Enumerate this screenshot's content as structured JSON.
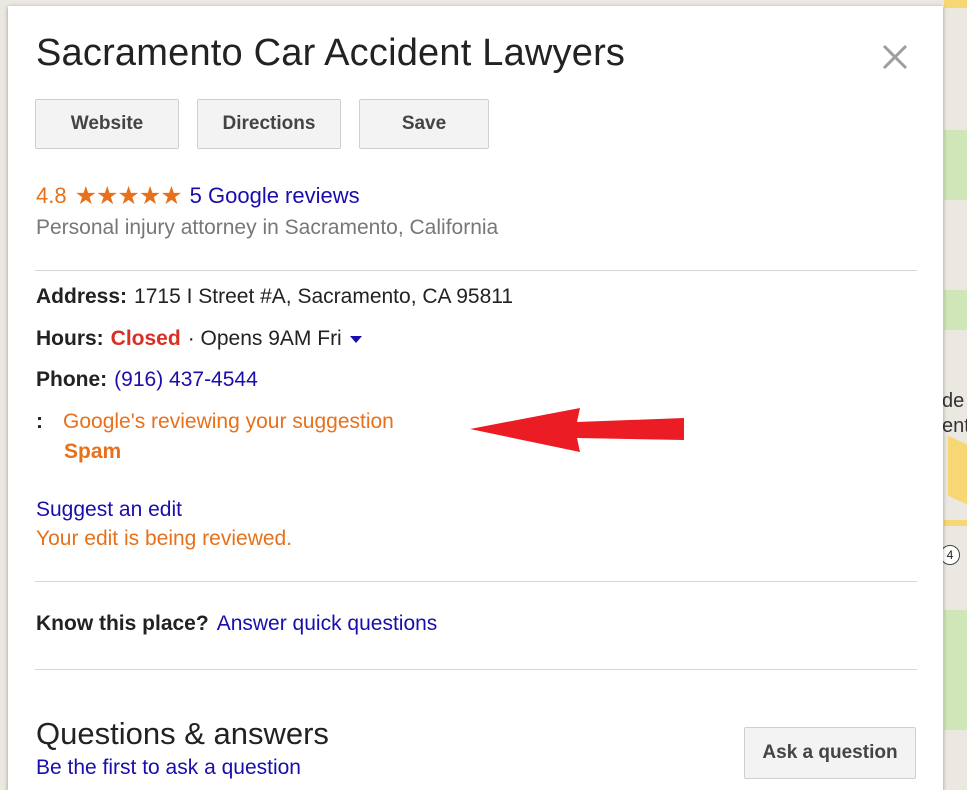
{
  "place": {
    "title": "Sacramento Car Accident Lawyers",
    "rating": "4.8",
    "stars": "★★★★★",
    "reviews_link": "5 Google reviews",
    "category": "Personal injury attorney in Sacramento, California"
  },
  "actions": {
    "website": "Website",
    "directions": "Directions",
    "save": "Save"
  },
  "info": {
    "address_label": "Address:",
    "address_value": "1715 I Street #A, Sacramento, CA 95811",
    "hours_label": "Hours:",
    "hours_status": "Closed",
    "hours_detail": "· Opens 9AM Fri",
    "phone_label": "Phone:",
    "phone_value": "(916) 437-4544",
    "suggestion_colon": ":",
    "suggestion_status": "Google's reviewing your suggestion",
    "suggestion_value": "Spam"
  },
  "edit": {
    "suggest_link": "Suggest an edit",
    "status": "Your edit is being reviewed."
  },
  "know": {
    "label": "Know this place?",
    "link": "Answer quick questions"
  },
  "qa": {
    "title": "Questions & answers",
    "subtitle": "Be the first to ask a question",
    "ask_button": "Ask a question"
  },
  "map": {
    "label_line1": "de",
    "label_line2": "ent",
    "shield": "4"
  },
  "colors": {
    "accent_orange": "#e7711b",
    "link_blue": "#1a0dab",
    "closed_red": "#d93025",
    "annotation_arrow": "#ec1c24"
  }
}
